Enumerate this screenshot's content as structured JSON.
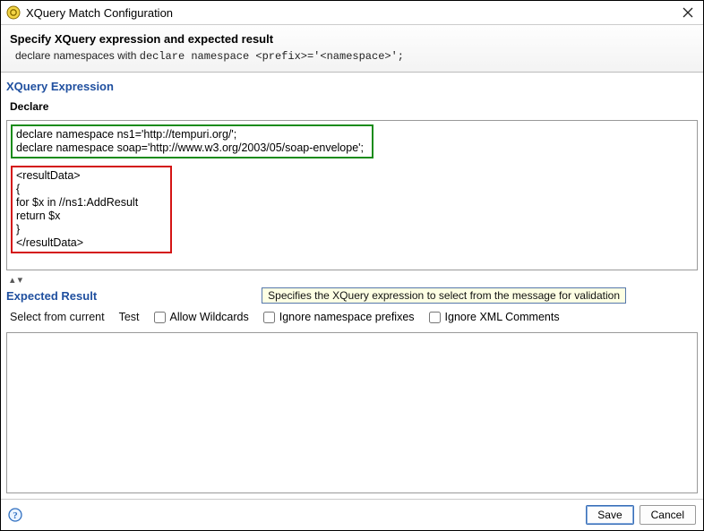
{
  "titlebar": {
    "title": "XQuery Match Configuration"
  },
  "subheader": {
    "heading": "Specify XQuery expression and expected result",
    "hint_prefix": "declare namespaces with ",
    "hint_code": "declare namespace <prefix>='<namespace>';"
  },
  "xquery": {
    "section_label": "XQuery Expression",
    "declare_label": "Declare",
    "decl_box": "declare namespace ns1='http://tempuri.org/';\ndeclare namespace soap='http://www.w3.org/2003/05/soap-envelope';",
    "body_box": "<resultData>\n{\nfor $x in //ns1:AddResult\nreturn $x\n}\n</resultData>"
  },
  "splitter_glyph": "▴ ▾",
  "expected": {
    "section_label": "Expected Result",
    "tooltip": "Specifies the XQuery expression to select from the message for validation",
    "select_from_current": "Select from current",
    "test": "Test",
    "allow_wildcards": "Allow Wildcards",
    "ignore_ns": "Ignore namespace prefixes",
    "ignore_xml_comments": "Ignore XML Comments"
  },
  "footer": {
    "save": "Save",
    "cancel": "Cancel"
  }
}
